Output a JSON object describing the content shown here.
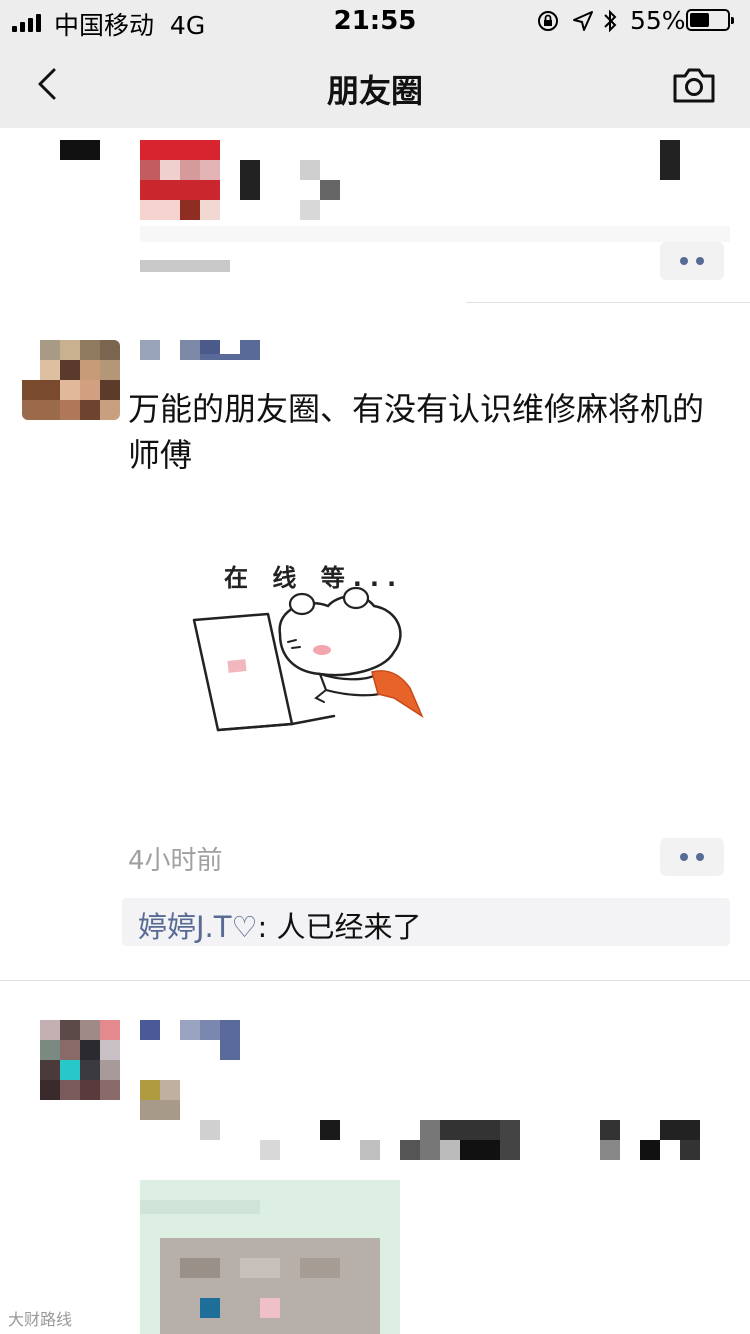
{
  "status_bar": {
    "carrier": "中国移动",
    "network": "4G",
    "time": "21:55",
    "battery_percent": "55%",
    "battery_level": 0.55
  },
  "nav": {
    "title": "朋友圈",
    "back_icon": "chevron-left-icon",
    "camera_icon": "camera-icon"
  },
  "posts": [
    {
      "time_label": "",
      "more_icon": "more-dots-icon"
    },
    {
      "text": "万能的朋友圈、有没有认识维修麻将机的师傅",
      "sticker_text": "在 线 等...",
      "time_label": "4小时前",
      "comments": [
        {
          "user": "婷婷J.T♡",
          "separator": ": ",
          "text": "人已经来了"
        }
      ]
    }
  ],
  "watermark": "大财路线",
  "colors": {
    "link": "#576b95",
    "bar_bg": "#ededed"
  }
}
